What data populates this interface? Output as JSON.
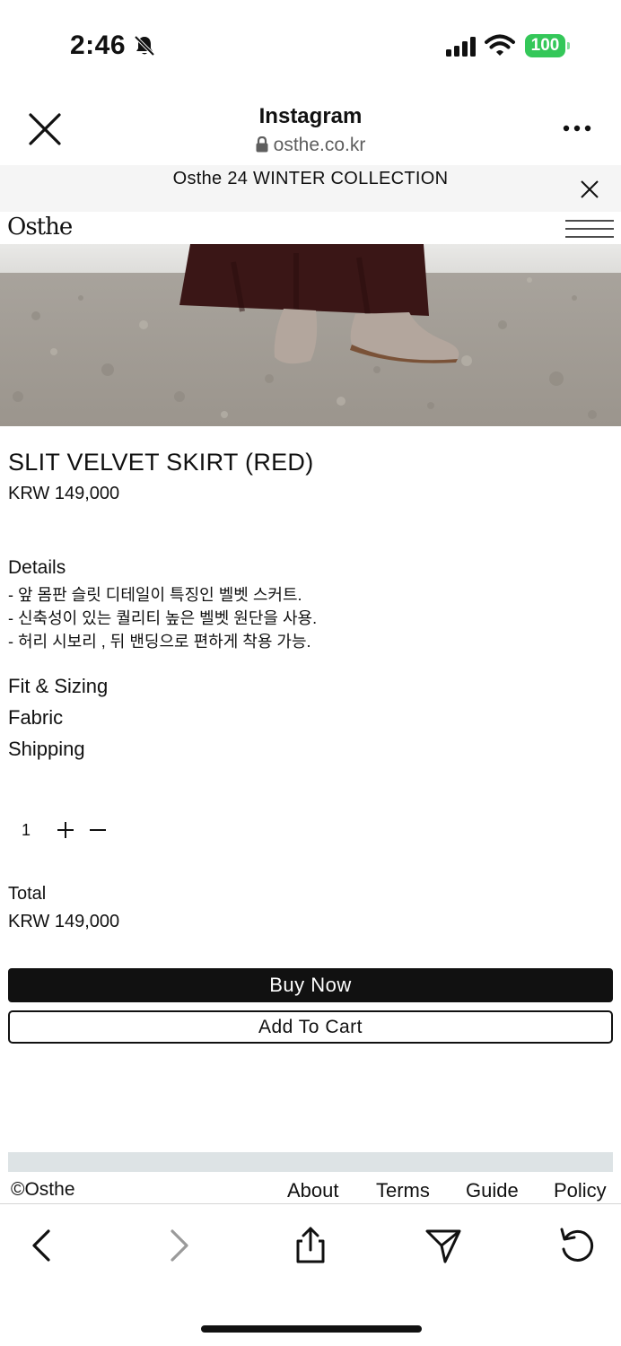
{
  "status_bar": {
    "time": "2:46",
    "battery_level": "100",
    "icons": [
      "bell-slash-icon",
      "cellular-signal-icon",
      "wifi-icon",
      "battery-icon"
    ],
    "battery_color": "#34c759"
  },
  "browser": {
    "title": "Instagram",
    "url": "osthe.co.kr",
    "icons": [
      "close-icon",
      "lock-icon",
      "more-icon"
    ]
  },
  "promo": {
    "text": "Osthe 24 WINTER COLLECTION"
  },
  "site": {
    "logo": "Osthe"
  },
  "product": {
    "name": "SLIT VELVET SKIRT (RED)",
    "price": "KRW 149,000",
    "details_title": "Details",
    "details": [
      "- 앞 몸판 슬릿 디테일이 특징인 벨벳 스커트.",
      "- 신축성이 있는 퀄리티 높은 벨벳 원단을 사용.",
      "- 허리 시보리 , 뒤 밴딩으로 편하게 착용 가능."
    ],
    "sections": [
      "Fit & Sizing",
      "Fabric",
      "Shipping"
    ],
    "quantity": "1",
    "total_label": "Total",
    "total_value": "KRW 149,000",
    "buy_label": "Buy Now",
    "cart_label": "Add To Cart"
  },
  "footer": {
    "copyright": "©Osthe",
    "links": [
      "About",
      "Terms",
      "Guide",
      "Policy"
    ]
  },
  "toolbar": {
    "icons": [
      "back-icon",
      "forward-icon",
      "share-icon",
      "send-icon",
      "reload-icon"
    ]
  },
  "colors": {
    "accent": "#111111",
    "promo_bg": "#f5f5f5",
    "footer_strip": "#dde3e5",
    "skirt": "#3a1616"
  }
}
